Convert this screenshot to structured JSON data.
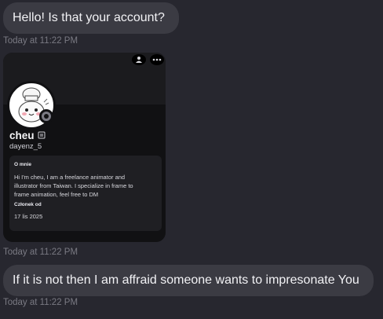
{
  "messages": [
    {
      "text": "Hello! Is that your account?",
      "timestamp": "Today at 11:22 PM"
    },
    {
      "timestamp": "Today at 11:22 PM"
    },
    {
      "text": "If it is not then I am affraid someone wants to impresonate You",
      "timestamp": "Today at 11:22 PM"
    }
  ],
  "profile_card": {
    "display_name": "cheu",
    "username": "dayenz_5",
    "about_heading": "O mnie",
    "bio": "Hi I'm cheu, I am a freelance animator and\nillustrator from Taiwan. I specialize in frame to\nframe animation, feel free to DM",
    "member_since_heading": "Członek od",
    "member_since": "17 lis 2025",
    "top_icons": [
      "add-friend-icon",
      "more-icon"
    ],
    "badge_icon": "nitro-badge-icon"
  },
  "colors": {
    "background": "#27272f",
    "bubble": "#3b3b43",
    "card": "#111113",
    "timestamp": "#7a7a83"
  }
}
